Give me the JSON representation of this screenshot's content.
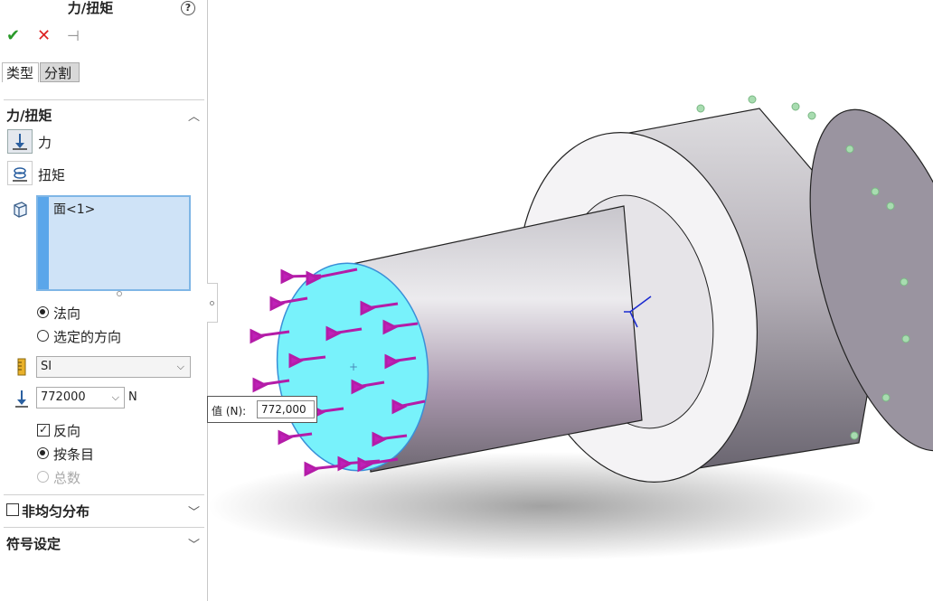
{
  "panel": {
    "title": "力/扭矩",
    "tabs": [
      "类型",
      "分割"
    ]
  },
  "force_section": {
    "title": "力/扭矩",
    "force_label": "力",
    "torque_label": "扭矩",
    "selection_item": "面<1>",
    "direction_options": [
      "法向",
      "选定的方向"
    ],
    "unit_value": "SI",
    "force_value": "772000",
    "force_unit": "N",
    "reverse_label": "反向",
    "per_item_label": "按条目",
    "total_label": "总数"
  },
  "nonuniform_section": {
    "title": "非均匀分布"
  },
  "symbol_section": {
    "title": "符号设定"
  },
  "callout": {
    "key": "值 (N):",
    "value": "772,000"
  }
}
